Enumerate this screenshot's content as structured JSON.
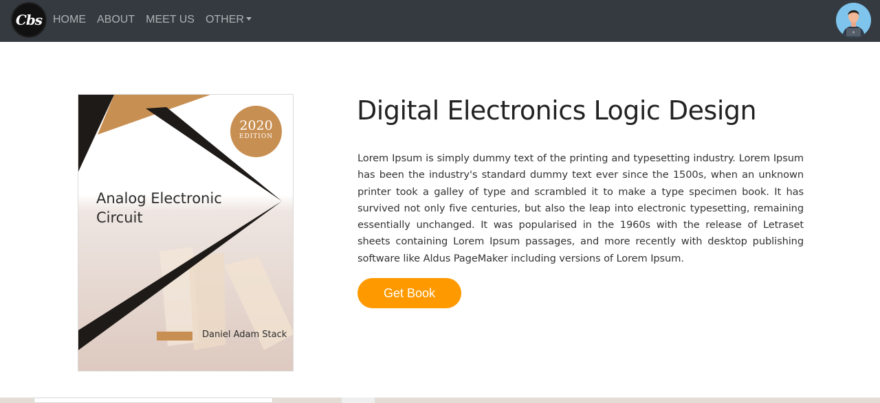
{
  "navbar": {
    "logo_text": "Cbs",
    "links": [
      "HOME",
      "ABOUT",
      "MEET US",
      "OTHER"
    ],
    "avatar_icon": "user-avatar-icon"
  },
  "book": {
    "cover_title": "Analog Electronic Circuit",
    "badge_year": "2020",
    "badge_label": "EDITION",
    "author": "Daniel Adam Stack",
    "heading": "Digital Electronics Logic Design",
    "description": "Lorem Ipsum is simply dummy text of the printing and typesetting industry. Lorem Ipsum has been the industry's standard dummy text ever since the 1500s, when an unknown printer took a galley of type and scrambled it to make a type specimen book. It has survived not only five centuries, but also the leap into electronic typesetting, remaining essentially unchanged. It was popularised in the 1960s with the release of Letraset sheets containing Lorem Ipsum passages, and more recently with desktop publishing software like Aldus PageMaker including versions of Lorem Ipsum.",
    "button_label": "Get Book"
  },
  "colors": {
    "navbar_bg": "#343a40",
    "accent": "#ff9900",
    "cover_accent": "#c88f52"
  }
}
